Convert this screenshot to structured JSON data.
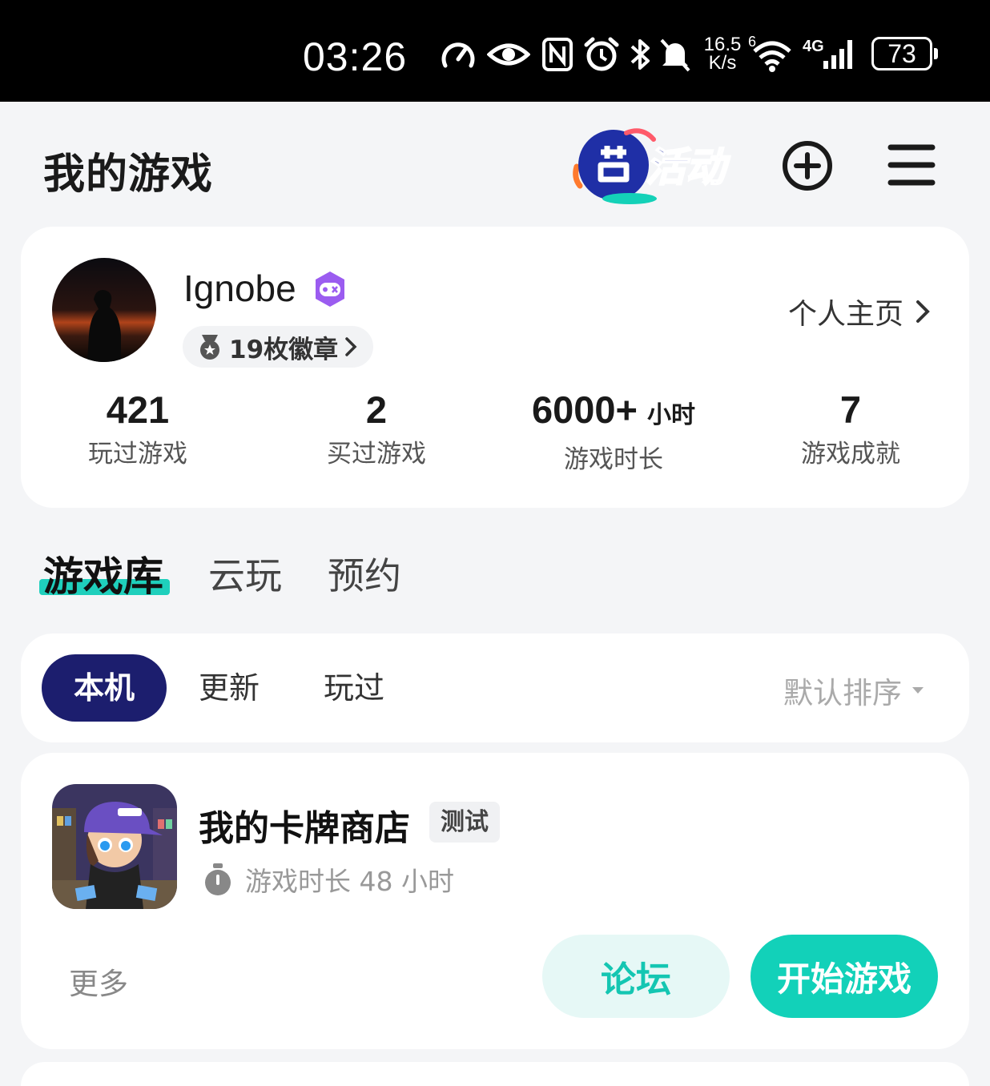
{
  "status_bar": {
    "time": "03:26",
    "net_speed_value": "16.5",
    "net_speed_unit": "K/s",
    "wifi_label": "6",
    "cell_label": "4G",
    "battery": "73",
    "icons": [
      "speedometer-icon",
      "eye-icon",
      "nfc-icon",
      "alarm-icon",
      "bluetooth-icon",
      "mute-icon",
      "wifi-icon",
      "signal-icon",
      "battery-icon"
    ]
  },
  "header": {
    "title": "我的游戏",
    "activity_label": "活动"
  },
  "profile": {
    "username": "Ignobe",
    "medals": "19枚徽章",
    "profile_link": "个人主页",
    "stats": [
      {
        "value": "421",
        "unit": "",
        "label": "玩过游戏"
      },
      {
        "value": "2",
        "unit": "",
        "label": "买过游戏"
      },
      {
        "value": "6000+",
        "unit": "小时",
        "label": "游戏时长"
      },
      {
        "value": "7",
        "unit": "",
        "label": "游戏成就"
      }
    ]
  },
  "library_tabs": [
    {
      "label": "游戏库",
      "active": true
    },
    {
      "label": "云玩",
      "active": false
    },
    {
      "label": "预约",
      "active": false
    }
  ],
  "filters": {
    "chips": [
      {
        "label": "本机",
        "active": true
      },
      {
        "label": "更新",
        "active": false
      },
      {
        "label": "玩过",
        "active": false
      }
    ],
    "sort_label": "默认排序"
  },
  "game": {
    "title": "我的卡牌商店",
    "tag": "测试",
    "playtime": "游戏时长 48 小时",
    "more": "更多",
    "forum_button": "论坛",
    "play_button": "开始游戏"
  },
  "colors": {
    "accent_teal": "#12d1b9",
    "chip_active": "#1c1e6e",
    "background": "#f4f5f7"
  }
}
